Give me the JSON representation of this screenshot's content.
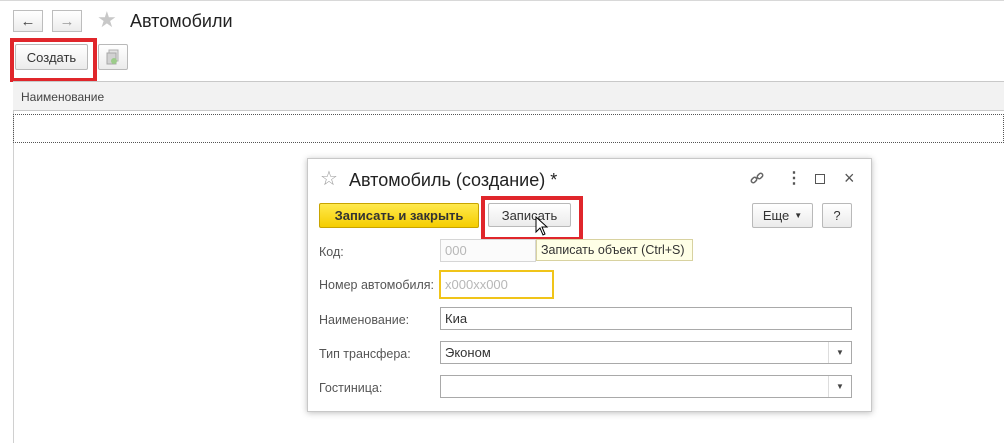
{
  "window": {
    "title": "Автомобили"
  },
  "nav": {
    "back_icon": "arrow-left-icon",
    "forward_icon": "arrow-right-icon",
    "favorite_icon": "star-icon"
  },
  "toolbar": {
    "create_label": "Создать",
    "copy_icon": "copy-icon"
  },
  "table": {
    "columns": [
      "Наименование"
    ],
    "rows": []
  },
  "dialog": {
    "title": "Автомобиль (создание) *",
    "favorite_icon": "star-outline-icon",
    "header_icons": [
      "link-icon",
      "more-icon",
      "maximize-icon",
      "close-icon"
    ],
    "buttons": {
      "save_close": "Записать и закрыть",
      "save": "Записать",
      "more": "Еще",
      "help": "?"
    },
    "tooltip": "Записать объект (Ctrl+S)",
    "fields": {
      "code": {
        "label": "Код:",
        "value": "",
        "placeholder": "000"
      },
      "plate": {
        "label": "Номер автомобиля:",
        "value": "",
        "placeholder": "x000xx000"
      },
      "name": {
        "label": "Наименование:",
        "value": "Киа"
      },
      "transfer": {
        "label": "Тип трансфера:",
        "value": "Эконом"
      },
      "hotel": {
        "label": "Гостиница:",
        "value": ""
      }
    }
  },
  "colors": {
    "highlight": "#e0262b",
    "primary_button": "#f5cd00",
    "focus_border": "#f0c419"
  }
}
